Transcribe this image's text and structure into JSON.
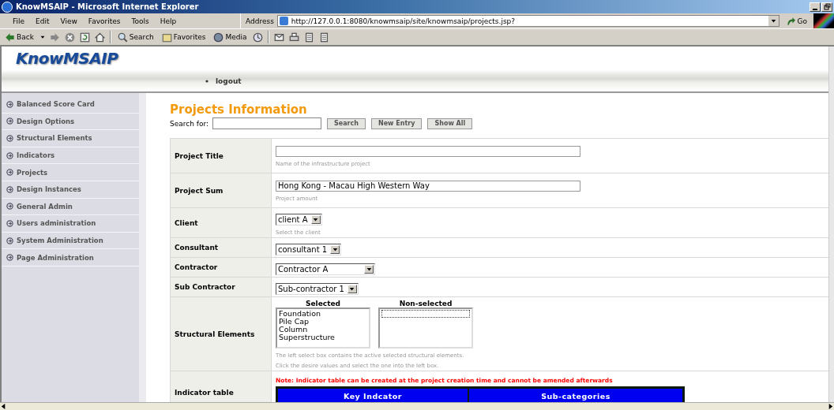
{
  "window": {
    "title": "KnowMSAIP - Microsoft Internet Explorer"
  },
  "menu": [
    "File",
    "Edit",
    "View",
    "Favorites",
    "Tools",
    "Help"
  ],
  "address": {
    "label": "Address",
    "url": "http://127.0.0.1:8080/knowmsaip/site/knowmsaip/projects.jsp?",
    "go": "Go"
  },
  "toolbar": [
    {
      "kind": "back",
      "label": "Back"
    },
    {
      "kind": "forward"
    },
    {
      "kind": "stop"
    },
    {
      "kind": "refresh"
    },
    {
      "kind": "home"
    },
    {
      "kind": "search",
      "label": "Search"
    },
    {
      "kind": "favorites",
      "label": "Favorites"
    },
    {
      "kind": "media",
      "label": "Media"
    },
    {
      "kind": "history"
    },
    {
      "kind": "mail"
    },
    {
      "kind": "print"
    },
    {
      "kind": "edit"
    },
    {
      "kind": "discuss"
    }
  ],
  "logo": "KnowMSAIP",
  "nav_links": [
    "logout"
  ],
  "sidebar": {
    "items": [
      "Balanced Score Card",
      "Design Options",
      "Structural Elements",
      "Indicators",
      "Projects",
      "Design Instances",
      "General Admin",
      "Users administration",
      "System Administration",
      "Page Administration"
    ]
  },
  "heading": "Projects Information",
  "search": {
    "label": "Search for:",
    "buttons": [
      "Search",
      "New Entry",
      "Show All"
    ]
  },
  "form": [
    {
      "kind": "text",
      "label": "Project Title",
      "hint": "Name of the infrastructure project"
    },
    {
      "kind": "text",
      "label": "Project Sum",
      "value": "Hong Kong - Macau High Western Way",
      "hint": "Project amount"
    },
    {
      "kind": "select",
      "label": "Client",
      "value": "client A",
      "hint": "Select the client"
    },
    {
      "kind": "select",
      "label": "Consultant",
      "value": "consultant 1"
    },
    {
      "kind": "select",
      "label": "Contractor",
      "value": "Contractor A"
    },
    {
      "kind": "select",
      "label": "Sub Contractor",
      "value": "Sub-contractor 1"
    },
    {
      "kind": "dual-list",
      "label": "Structural Elements",
      "selected_heading": "Selected",
      "non_selected_heading": "Non-selected",
      "selected": [
        "Foundation",
        "Pile Cap",
        "Column",
        "Superstructure"
      ],
      "hints": [
        "The left select box contains the active selected structural elements.",
        "Click the desire values and select the one into the left box."
      ]
    },
    {
      "kind": "indicator",
      "label": "Indicator table",
      "note": "Note: Indicator table can be created at the project creation time and cannot be amended afterwards",
      "columns": [
        "Key Indcator",
        "Sub-categories"
      ]
    }
  ]
}
